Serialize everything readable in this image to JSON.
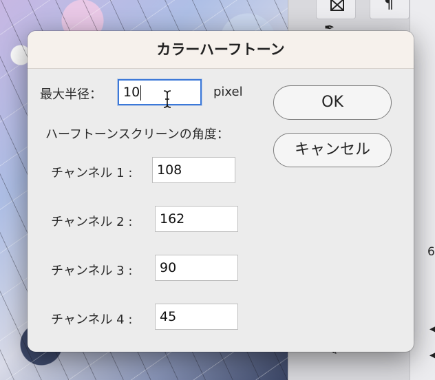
{
  "dialog": {
    "title": "カラーハーフトーン",
    "max_radius": {
      "label": "最大半径：",
      "value": "10",
      "unit": "pixel"
    },
    "screen_angles_heading": "ハーフトーンスクリーンの角度：",
    "channels": [
      {
        "label": "チャンネル 1 :",
        "value": "108"
      },
      {
        "label": "チャンネル 2 :",
        "value": "162"
      },
      {
        "label": "チャンネル 3 :",
        "value": "90"
      },
      {
        "label": "チャンネル 4 :",
        "value": "45"
      }
    ],
    "ok_label": "OK",
    "cancel_label": "キャンセル"
  },
  "background": {
    "panel_number": "6",
    "icons": [
      "crop-frame-icon",
      "paragraph-icon",
      "brush-icon"
    ]
  },
  "colors": {
    "focus_ring": "#3b78d8",
    "dialog_bg": "#ececec",
    "titlebar_bg": "#f6f1ec"
  }
}
